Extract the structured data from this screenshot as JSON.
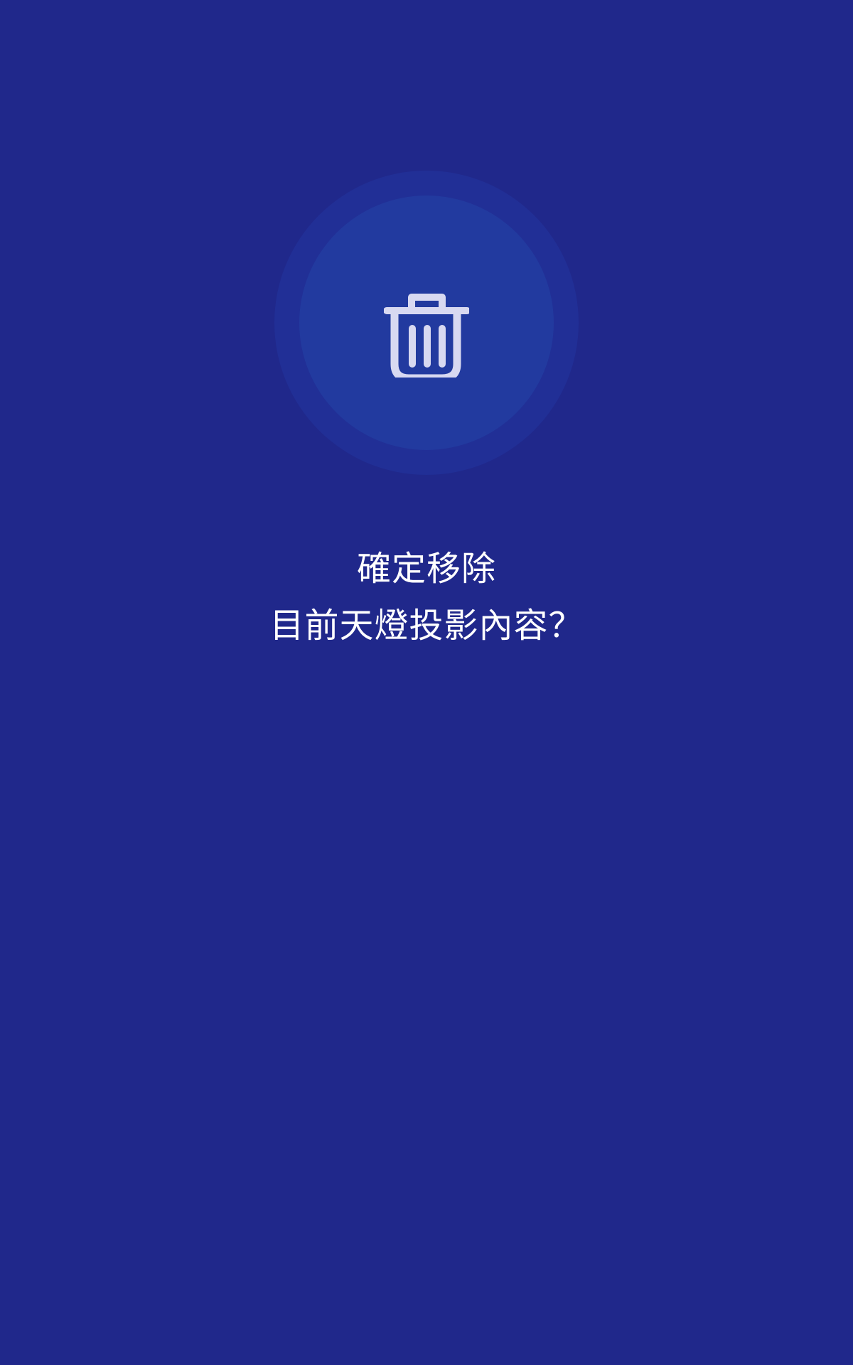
{
  "dialog": {
    "icon": "trash-icon",
    "line1": "確定移除",
    "line2": "目前天燈投影內容？"
  },
  "colors": {
    "background": "#20288b",
    "icon_ring_outer": "#212f96",
    "icon_ring_inner": "#223a9f",
    "icon": "#d8d9f1",
    "text": "#ffffff"
  }
}
